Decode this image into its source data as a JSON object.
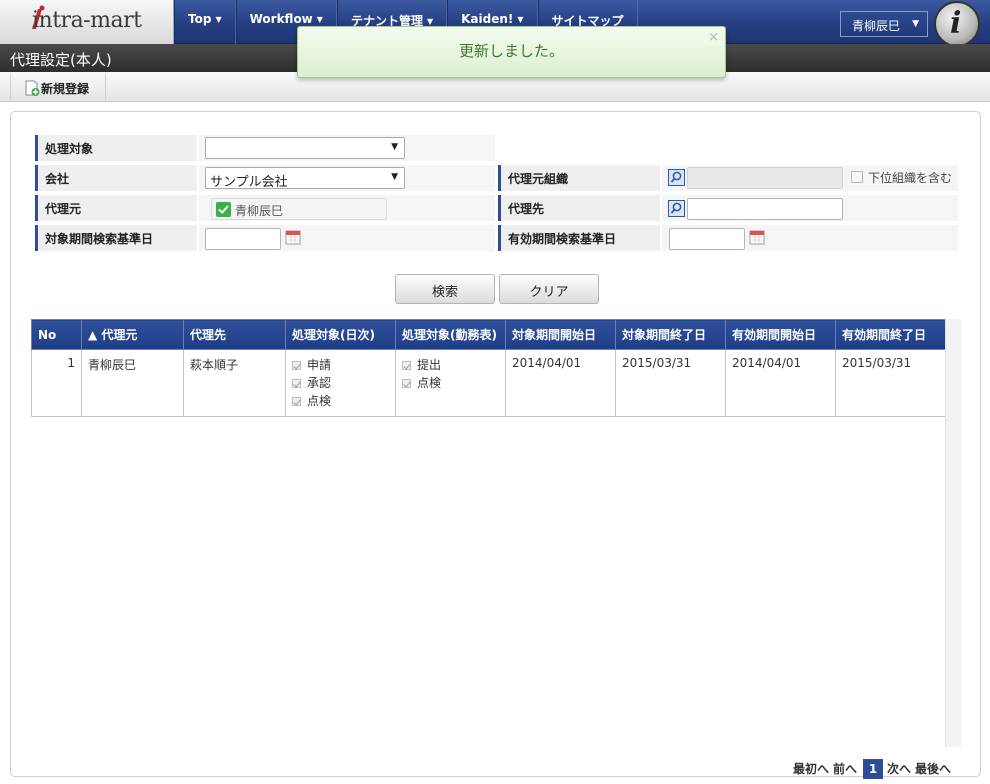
{
  "app": {
    "logo_text": "intra-mart",
    "nav": [
      {
        "label": "Top"
      },
      {
        "label": "Workflow"
      },
      {
        "label": "テナント管理"
      },
      {
        "label": "Kaiden!"
      },
      {
        "label": "サイトマップ"
      }
    ],
    "user_name": "青柳辰巳"
  },
  "page": {
    "title": "代理設定(本人)",
    "new_button_label": "新規登録"
  },
  "toast": {
    "message": "更新しました。",
    "close": "×"
  },
  "form": {
    "target_label": "処理対象",
    "target_value": "",
    "company_label": "会社",
    "company_value": "サンプル会社",
    "proxy_org_label": "代理元組織",
    "proxy_org_value": "",
    "include_sub_org_label": "下位組織を含む",
    "include_sub_org_checked": false,
    "proxy_source_label": "代理元",
    "proxy_source_value": "青柳辰巳",
    "proxy_dest_label": "代理先",
    "proxy_dest_value": "",
    "target_period_label": "対象期間検索基準日",
    "target_period_value": "",
    "valid_period_label": "有効期間検索基準日",
    "valid_period_value": ""
  },
  "buttons": {
    "search": "検索",
    "clear": "クリア"
  },
  "table": {
    "headers": [
      "No",
      "▲ 代理元",
      "代理先",
      "処理対象(日次)",
      "処理対象(勤務表)",
      "対象期間開始日",
      "対象期間終了日",
      "有効期間開始日",
      "有効期間終了日"
    ],
    "rows": [
      {
        "no": "1",
        "source": "青柳辰巳",
        "dest": "萩本順子",
        "daily": [
          "申請",
          "承認",
          "点検"
        ],
        "timesheet": [
          "提出",
          "点検"
        ],
        "target_start": "2014/04/01",
        "target_end": "2015/03/31",
        "valid_start": "2014/04/01",
        "valid_end": "2015/03/31"
      }
    ]
  },
  "pager": {
    "first": "最初へ",
    "prev": "前へ",
    "current": "1",
    "next": "次へ",
    "last": "最後へ"
  }
}
